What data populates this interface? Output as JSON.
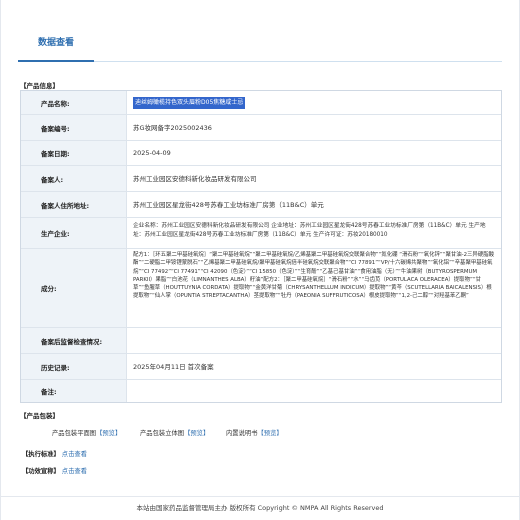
{
  "tab": {
    "label": "数据查看"
  },
  "section_product": "【产品信息】",
  "rows": [
    {
      "label": "产品名称:",
      "value": "迪丝姆橄榄持色双头眉粉D05焦糖咸士忌"
    },
    {
      "label": "备案编号:",
      "value": "苏G妆网备字2025002436"
    },
    {
      "label": "备案日期:",
      "value": "2025-04-09"
    },
    {
      "label": "备案人:",
      "value": "苏州工业园区安德科新化妆品研发有限公司"
    },
    {
      "label": "备案人住所地址:",
      "value": "苏州工业园区星龙街428号苏春工业坊标准厂房第（11B&C）单元"
    },
    {
      "label": "生产企业:",
      "value": "企业名称：苏州工业园区安德科新化妆品研发有限公司 企业地址：苏州工业园区星龙街428号苏春工业坊标准厂房第（11B&C）单元 生产地址：苏州工业园区星龙街428号苏春工业坊标准厂房第（11B&C）单元 生产许可证：苏妆20180010"
    },
    {
      "label": "成分:",
      "value": "配方1：［环五聚二甲基硅氧烷］“聚二甲基硅氧烷”“聚二甲基硅氧烷/乙烯基聚二甲基硅氧烷交联聚合物”“氮化硼 “滑石粉”“氧化锌”“聚甘油-2三异硬脂酸酯”“二硬脂二甲铵锂蒙脱石”“乙烯基聚二甲基硅氧烷/聚甲基硅氧烷倍半硅氧烷交联聚合物”“CI 77891”“VP/十六碳烯共聚物”“氧化铝”“辛基聚甲基硅氧烷”“CI 77492”“CI 77491”“CI 42090（色淀）”“CI 15850（色淀）”“生育酚”“乙基己基甘油”“食用油脂（无）”“牛油果树（BUTYROSPERMUM PARKII）果脂”“白池花（LIMNANTHES ALBA）籽油”配方2：［聚二甲基硅氧烷］“滑石粉”“水”“马齿苋（PORTULACA OLERACEA）提取物”“甘草”“鱼腥草（HOUTTUYNIA CORDATA）提取物”“金黄洋甘菊（CHRYSANTHELLUM INDICUM）提取物”“黄芩（SCUTELLARIA BAICALENSIS）根提取物”“仙人掌（OPUNTIA STREPTACANTHA）茎提取物”“牡丹（PAEONIA SUFFRUTICOSA）根皮提取物”“1,2-己二醇”“对羟基苯乙酮”"
    },
    {
      "label": "备案后监督检查情况:",
      "value": ""
    },
    {
      "label": "历史记录:",
      "value": "2025年04月11日 首次备案"
    },
    {
      "label": "备注:",
      "value": ""
    }
  ],
  "section_package": "【产品包装】",
  "package": {
    "item1_label": "产品包装平面图",
    "item1_link": "【预览】",
    "item2_label": "产品包装立体图",
    "item2_link": "【预览】",
    "item3_label": "内置说明书",
    "item3_link": "【预览】"
  },
  "section_standard": "【执行标准】",
  "standard_link": "点击查看",
  "section_efficacy": "【功效宣称】",
  "efficacy_link": "点击查看",
  "footer": "本站由国家药品监督管理局主办 版权所有 Copyright © NMPA All Rights Reserved"
}
